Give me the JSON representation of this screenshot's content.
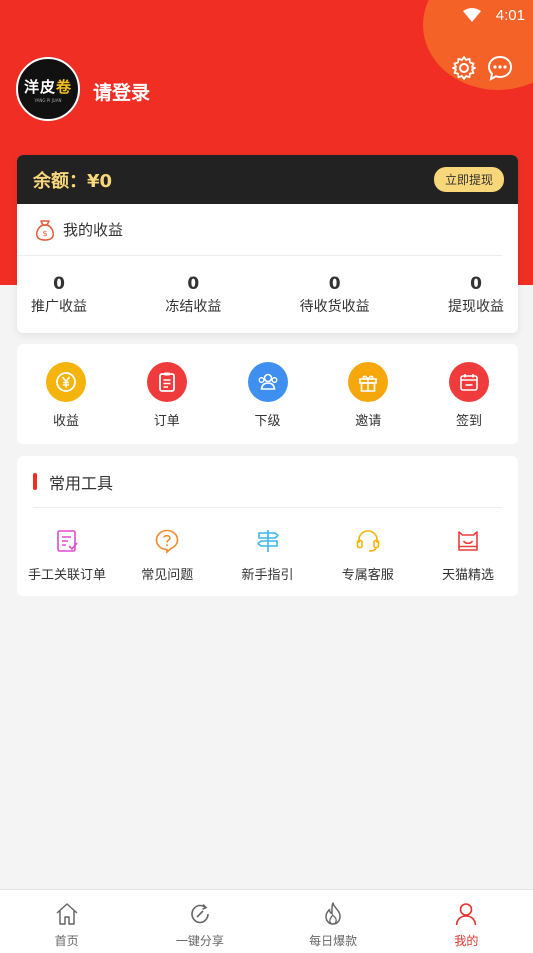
{
  "status_bar": {
    "time": "4:01"
  },
  "profile": {
    "logo_text": "洋皮",
    "logo_char": "卷",
    "logo_sub": "YANG PI JUAN",
    "login_label": "请登录"
  },
  "balance": {
    "label": "余额：¥0",
    "withdraw_label": "立即提现"
  },
  "earnings": {
    "title": "我的收益",
    "stats": [
      {
        "value": "0",
        "label": "推广收益"
      },
      {
        "value": "0",
        "label": "冻结收益"
      },
      {
        "value": "0",
        "label": "待收货收益"
      },
      {
        "value": "0",
        "label": "提现收益"
      }
    ]
  },
  "quick_menu": [
    {
      "label": "收益",
      "icon": "yen-coin-icon",
      "color": "#f5b40c"
    },
    {
      "label": "订单",
      "icon": "clipboard-icon",
      "color": "#ef3b3b"
    },
    {
      "label": "下级",
      "icon": "team-icon",
      "color": "#3f8ff0"
    },
    {
      "label": "邀请",
      "icon": "gift-icon",
      "color": "#f6a70c"
    },
    {
      "label": "签到",
      "icon": "calendar-icon",
      "color": "#ef3b3b"
    }
  ],
  "tools": {
    "title": "常用工具",
    "items": [
      {
        "label": "手工关联订单",
        "icon": "link-order-icon",
        "color": "#e04bd0"
      },
      {
        "label": "常见问题",
        "icon": "question-bubble-icon",
        "color": "#f08a2b"
      },
      {
        "label": "新手指引",
        "icon": "signpost-icon",
        "color": "#3ab7ea"
      },
      {
        "label": "专属客服",
        "icon": "headset-icon",
        "color": "#f5b40c"
      },
      {
        "label": "天猫精选",
        "icon": "tmall-icon",
        "color": "#ef3b3b"
      }
    ]
  },
  "tabbar": [
    {
      "label": "首页",
      "icon": "home-icon"
    },
    {
      "label": "一键分享",
      "icon": "share-icon"
    },
    {
      "label": "每日爆款",
      "icon": "flame-icon"
    },
    {
      "label": "我的",
      "icon": "user-icon",
      "active": true
    }
  ],
  "colors": {
    "primary": "#f02e24",
    "gold": "#f8d67a",
    "dark": "#222222"
  }
}
